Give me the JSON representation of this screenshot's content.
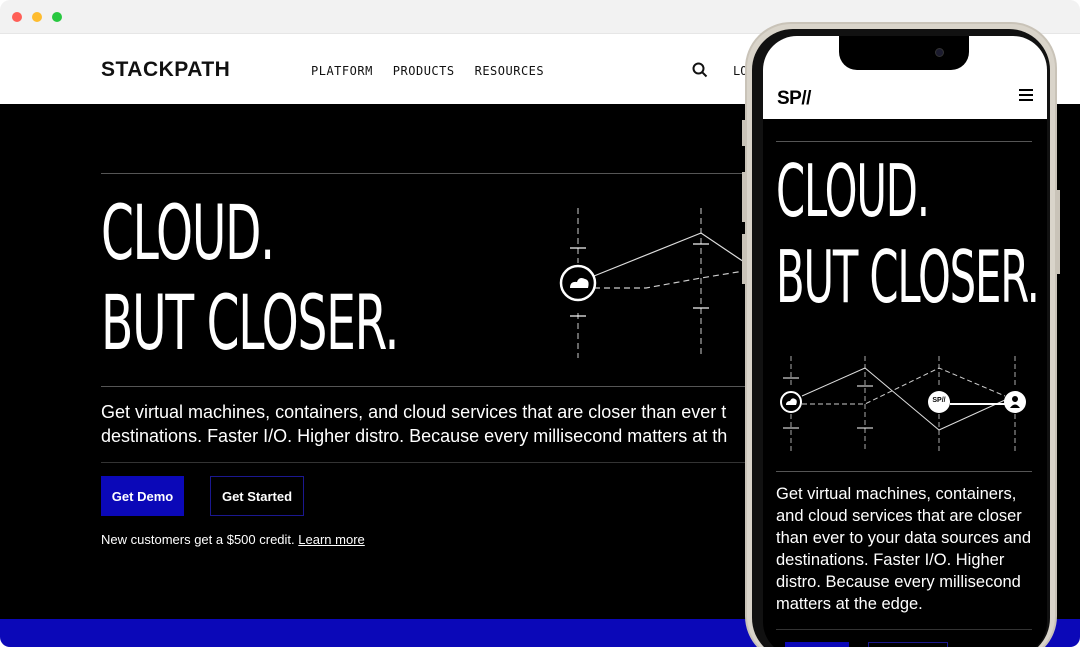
{
  "header": {
    "logo": "STACKPATH",
    "nav": [
      "PLATFORM",
      "PRODUCTS",
      "RESOURCES"
    ],
    "login_label": "LO"
  },
  "hero": {
    "headline_line1": "CLOUD.",
    "headline_line2": "BUT CLOSER.",
    "lede_line1": "Get virtual machines, containers, and cloud services that are closer than ever t",
    "lede_line2": "destinations. Faster I/O. Higher distro. Because every millisecond matters at th",
    "demo_button": "Get Demo",
    "start_button": "Get Started",
    "credit_text": "New customers get a $500 credit.",
    "learn_more": "Learn more"
  },
  "mobile": {
    "logo": "SP//",
    "headline_line1": "CLOUD.",
    "headline_line2": "BUT CLOSER.",
    "node_label": "SP//",
    "lede": "Get virtual machines, containers, and cloud services that are closer than ever to your data sources and destinations. Faster I/O. Higher distro. Because every millisecond matters at the edge."
  },
  "colors": {
    "accent_blue": "#0b08b8",
    "hero_bg": "#000000"
  }
}
